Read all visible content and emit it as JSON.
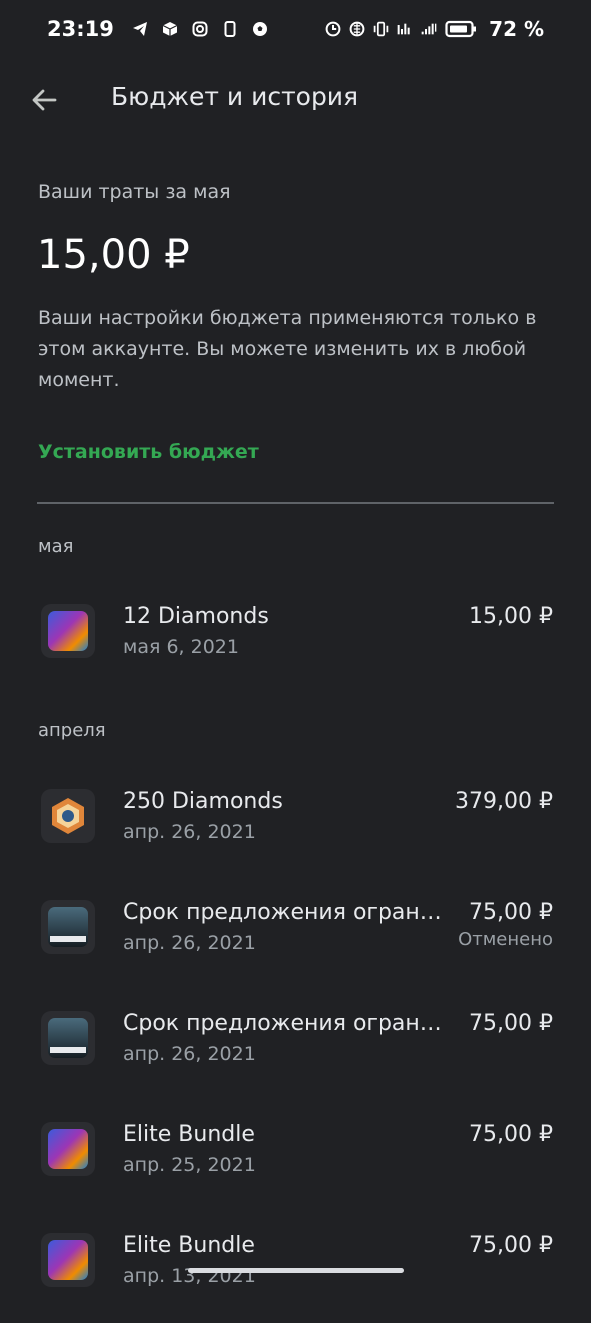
{
  "status_bar": {
    "time": "23:19",
    "battery_percent": "72 %",
    "left_icons": [
      "telegram-icon",
      "box-icon",
      "instagram-icon",
      "phone-icon",
      "soccer-ball-icon"
    ],
    "right_icons": [
      "clock-icon",
      "globe-icon",
      "vibrate-icon",
      "signal-icon",
      "signal-icon",
      "battery-icon"
    ]
  },
  "header": {
    "title": "Бюджет и история"
  },
  "summary": {
    "label": "Ваши траты за мая",
    "amount": "15,00 ₽",
    "info": "Ваши настройки бюджета применяются только в этом аккаунте. Вы можете изменить их в любой момент.",
    "set_budget_label": "Установить бюджет"
  },
  "sections": [
    {
      "title": "мая",
      "items": [
        {
          "name": "12 Diamonds",
          "date": "мая 6, 2021",
          "amount": "15,00 ₽",
          "status": "",
          "icon": "mobile-legends-icon"
        }
      ]
    },
    {
      "title": "апреля",
      "items": [
        {
          "name": "250 Diamonds",
          "date": "апр. 26, 2021",
          "amount": "379,00 ₽",
          "status": "",
          "icon": "hexagon-game-icon"
        },
        {
          "name": "Срок предложения огран…",
          "date": "апр. 26, 2021",
          "amount": "75,00 ₽",
          "status": "Отменено",
          "icon": "call-of-duty-icon"
        },
        {
          "name": "Срок предложения огран…",
          "date": "апр. 26, 2021",
          "amount": "75,00 ₽",
          "status": "",
          "icon": "call-of-duty-icon"
        },
        {
          "name": "Elite Bundle",
          "date": "апр. 25, 2021",
          "amount": "75,00 ₽",
          "status": "",
          "icon": "mobile-legends-icon"
        },
        {
          "name": "Elite Bundle",
          "date": "апр. 13, 2021",
          "amount": "75,00 ₽",
          "status": "",
          "icon": "mobile-legends-icon"
        }
      ]
    }
  ],
  "colors": {
    "background": "#202124",
    "accent": "#34a853",
    "text_primary": "#e8eaed",
    "text_secondary": "#9aa0a6"
  }
}
